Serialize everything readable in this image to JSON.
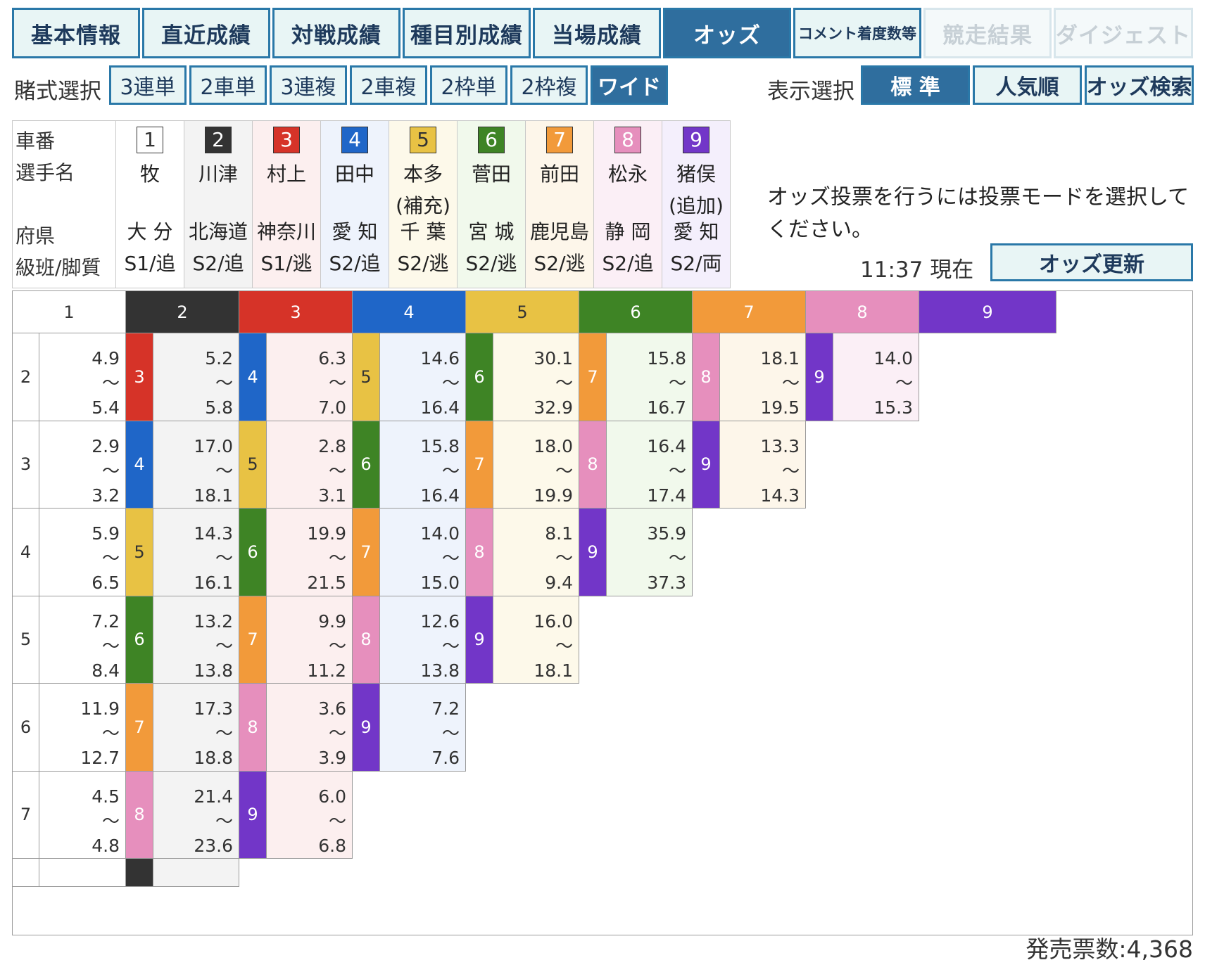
{
  "tabs": [
    {
      "label": "基本情報",
      "state": "normal"
    },
    {
      "label": "直近成績",
      "state": "normal"
    },
    {
      "label": "対戦成績",
      "state": "normal"
    },
    {
      "label": "種目別成績",
      "state": "normal"
    },
    {
      "label": "当場成績",
      "state": "normal"
    },
    {
      "label": "オッズ",
      "state": "active"
    },
    {
      "label": "コメント着度数等",
      "state": "small"
    },
    {
      "label": "競走結果",
      "state": "disabled"
    },
    {
      "label": "ダイジェスト",
      "state": "disabled"
    }
  ],
  "bet_select": {
    "label": "賭式選択",
    "options": [
      "3連単",
      "2車単",
      "3連複",
      "2車複",
      "2枠単",
      "2枠複",
      "ワイド"
    ],
    "selected": "ワイド"
  },
  "view_select": {
    "label": "表示選択",
    "options": [
      "標 準",
      "人気順",
      "オッズ検索"
    ],
    "selected": "標 準"
  },
  "racer_headers": {
    "car_no": "車番",
    "name": "選手名",
    "pref": "府県",
    "class": "級班/脚質"
  },
  "racers": [
    {
      "no": "1",
      "name": "牧",
      "pref": "大 分",
      "class": "S1/追",
      "color": "#ffffff",
      "text_color": "#333333",
      "bg": "#ffffff"
    },
    {
      "no": "2",
      "name": "川津",
      "pref": "北海道",
      "class": "S2/追",
      "color": "#333333",
      "text_color": "#ffffff",
      "bg": "#f3f3f3"
    },
    {
      "no": "3",
      "name": "村上",
      "pref": "神奈川",
      "class": "S1/逃",
      "color": "#d63328",
      "text_color": "#ffffff",
      "bg": "#fcefef"
    },
    {
      "no": "4",
      "name": "田中",
      "pref": "愛 知",
      "class": "S2/追",
      "color": "#1f66c8",
      "text_color": "#ffffff",
      "bg": "#eef3fc"
    },
    {
      "no": "5",
      "name": "本多\n(補充)",
      "pref": "千 葉",
      "class": "S2/逃",
      "color": "#e8c244",
      "text_color": "#333333",
      "bg": "#fdf9ea"
    },
    {
      "no": "6",
      "name": "菅田",
      "pref": "宮 城",
      "class": "S2/逃",
      "color": "#3e8425",
      "text_color": "#ffffff",
      "bg": "#f1f9ec"
    },
    {
      "no": "7",
      "name": "前田",
      "pref": "鹿児島",
      "class": "S2/逃",
      "color": "#f29a3a",
      "text_color": "#ffffff",
      "bg": "#fdf6ea"
    },
    {
      "no": "8",
      "name": "松永",
      "pref": "静 岡",
      "class": "S2/追",
      "color": "#e68fbd",
      "text_color": "#ffffff",
      "bg": "#fbeff6"
    },
    {
      "no": "9",
      "name": "猪俣\n(追加)",
      "pref": "愛 知",
      "class": "S2/両",
      "color": "#7236c8",
      "text_color": "#ffffff",
      "bg": "#f4effc"
    }
  ],
  "vote_note": "オッズ投票を行うには投票モードを選択してください。",
  "time_label": "11:37 現在",
  "update_button": "オッズ更新",
  "odds_columns": [
    "1",
    "2",
    "3",
    "4",
    "5",
    "6",
    "7",
    "8",
    "9"
  ],
  "odds_row_labels": [
    "2",
    "3",
    "4",
    "5",
    "6",
    "7"
  ],
  "odds": [
    [
      {
        "partner": "",
        "low": "4.9",
        "high": "5.4"
      },
      {
        "partner": "3",
        "low": "5.2",
        "high": "5.8"
      },
      {
        "partner": "4",
        "low": "6.3",
        "high": "7.0"
      },
      {
        "partner": "5",
        "low": "14.6",
        "high": "16.4"
      },
      {
        "partner": "6",
        "low": "30.1",
        "high": "32.9"
      },
      {
        "partner": "7",
        "low": "15.8",
        "high": "16.7"
      },
      {
        "partner": "8",
        "low": "18.1",
        "high": "19.5"
      },
      {
        "partner": "9",
        "low": "14.0",
        "high": "15.3"
      }
    ],
    [
      {
        "partner": "",
        "low": "2.9",
        "high": "3.2"
      },
      {
        "partner": "4",
        "low": "17.0",
        "high": "18.1"
      },
      {
        "partner": "5",
        "low": "2.8",
        "high": "3.1"
      },
      {
        "partner": "6",
        "low": "15.8",
        "high": "16.4"
      },
      {
        "partner": "7",
        "low": "18.0",
        "high": "19.9"
      },
      {
        "partner": "8",
        "low": "16.4",
        "high": "17.4"
      },
      {
        "partner": "9",
        "low": "13.3",
        "high": "14.3"
      }
    ],
    [
      {
        "partner": "",
        "low": "5.9",
        "high": "6.5"
      },
      {
        "partner": "5",
        "low": "14.3",
        "high": "16.1"
      },
      {
        "partner": "6",
        "low": "19.9",
        "high": "21.5"
      },
      {
        "partner": "7",
        "low": "14.0",
        "high": "15.0"
      },
      {
        "partner": "8",
        "low": "8.1",
        "high": "9.4"
      },
      {
        "partner": "9",
        "low": "35.9",
        "high": "37.3"
      }
    ],
    [
      {
        "partner": "",
        "low": "7.2",
        "high": "8.4"
      },
      {
        "partner": "6",
        "low": "13.2",
        "high": "13.8"
      },
      {
        "partner": "7",
        "low": "9.9",
        "high": "11.2"
      },
      {
        "partner": "8",
        "low": "12.6",
        "high": "13.8"
      },
      {
        "partner": "9",
        "low": "16.0",
        "high": "18.1"
      }
    ],
    [
      {
        "partner": "",
        "low": "11.9",
        "high": "12.7"
      },
      {
        "partner": "7",
        "low": "17.3",
        "high": "18.8"
      },
      {
        "partner": "8",
        "low": "3.6",
        "high": "3.9"
      },
      {
        "partner": "9",
        "low": "7.2",
        "high": "7.6"
      }
    ],
    [
      {
        "partner": "",
        "low": "4.5",
        "high": "4.8"
      },
      {
        "partner": "8",
        "low": "21.4",
        "high": "23.6"
      },
      {
        "partner": "9",
        "low": "6.0",
        "high": "6.8"
      }
    ]
  ],
  "tilde": "〜",
  "sales": "発売票数:4,368"
}
